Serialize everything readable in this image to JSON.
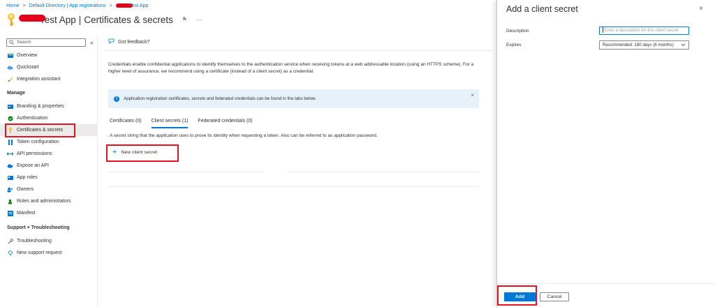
{
  "breadcrumb": {
    "items": [
      "Home",
      "Default Directory | App registrations",
      "Test App"
    ],
    "separator": ">"
  },
  "header": {
    "app_name": "Test App",
    "separator": "|",
    "page_title": "Certificates & secrets",
    "pin_icon": "pin-icon",
    "more_icon": "ellipsis-icon",
    "more_label": "···"
  },
  "sidebar": {
    "search_placeholder": "Search",
    "collapse_label": "«",
    "items_top": [
      {
        "label": "Overview",
        "icon": "grid-icon"
      },
      {
        "label": "Quickstart",
        "icon": "cloud-icon"
      },
      {
        "label": "Integration assistant",
        "icon": "rocket-icon"
      }
    ],
    "manage_header": "Manage",
    "items_manage": [
      {
        "label": "Branding & properties",
        "icon": "branding-icon"
      },
      {
        "label": "Authentication",
        "icon": "auth-icon"
      },
      {
        "label": "Certificates & secrets",
        "icon": "key-icon"
      },
      {
        "label": "Token configuration",
        "icon": "token-icon"
      },
      {
        "label": "API permissions",
        "icon": "arrows-icon"
      },
      {
        "label": "Expose an API",
        "icon": "cloud-api-icon"
      },
      {
        "label": "App roles",
        "icon": "roles-icon"
      },
      {
        "label": "Owners",
        "icon": "owners-icon"
      },
      {
        "label": "Roles and administrators",
        "icon": "admin-icon"
      },
      {
        "label": "Manifest",
        "icon": "manifest-icon"
      }
    ],
    "support_header": "Support + Troubleshooting",
    "items_support": [
      {
        "label": "Troubleshooting",
        "icon": "wrench-icon"
      },
      {
        "label": "New support request",
        "icon": "support-icon"
      }
    ]
  },
  "main": {
    "feedback_label": "Got feedback?",
    "description": "Credentials enable confidential applications to identify themselves to the authentication service when receiving tokens at a web addressable location (using an HTTPS scheme). For a higher level of assurance, we recommend using a certificate (instead of a client secret) as a credential.",
    "info_text": "Application registration certificates, secrets and federated credentials can be found in the tabs below.",
    "info_close": "×",
    "tabs": [
      {
        "label": "Certificates (0)",
        "active": false
      },
      {
        "label": "Client secrets (1)",
        "active": true
      },
      {
        "label": "Federated credentials (0)",
        "active": false
      }
    ],
    "tab_description": "A secret string that the application uses to prove its identity when requesting a token. Also can be referred to as application password.",
    "new_secret_label": "New client secret",
    "new_secret_plus": "+"
  },
  "panel": {
    "title": "Add a client secret",
    "close_label": "×",
    "description_label": "Description",
    "description_placeholder": "Enter a description for this client secret",
    "expires_label": "Expires",
    "expires_value": "Recommended: 180 days (6 months)",
    "add_label": "Add",
    "cancel_label": "Cancel"
  },
  "colors": {
    "accent": "#0078d4",
    "highlight_box": "#e81123",
    "info_bg": "#e7f1fa"
  }
}
